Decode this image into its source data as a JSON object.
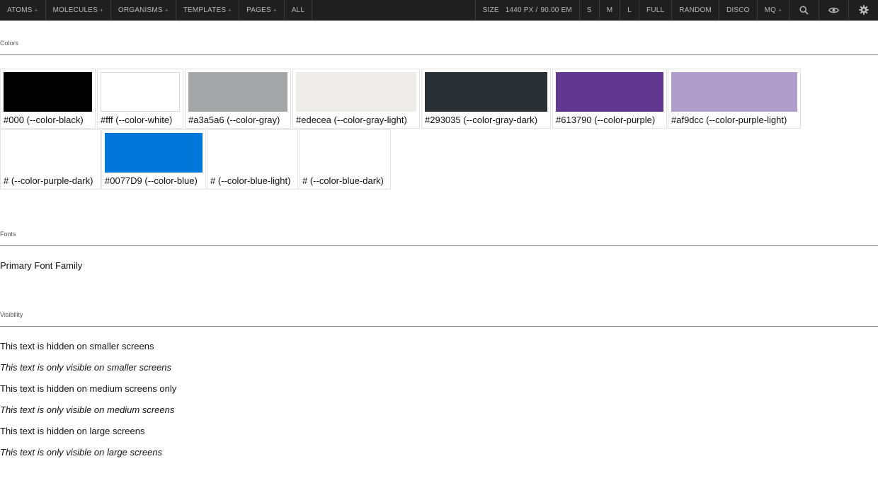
{
  "toolbar": {
    "nav": [
      {
        "label": "ATOMS",
        "has_menu": true
      },
      {
        "label": "MOLECULES",
        "has_menu": true
      },
      {
        "label": "ORGANISMS",
        "has_menu": true
      },
      {
        "label": "TEMPLATES",
        "has_menu": true
      },
      {
        "label": "PAGES",
        "has_menu": true
      },
      {
        "label": "ALL",
        "has_menu": false
      }
    ],
    "plus_glyph": "+",
    "size_label": "SIZE",
    "size_px": "1440 PX /",
    "size_em": "90.00 EM",
    "sizes": [
      "S",
      "M",
      "L",
      "FULL",
      "RANDOM",
      "DISCO",
      "MQ"
    ],
    "icons": [
      "search-icon",
      "eye-icon",
      "gear-icon"
    ]
  },
  "colors_section": {
    "title": "Colors",
    "swatches": [
      {
        "caption": "#000 (--color-black)",
        "color": "#000000"
      },
      {
        "caption": "#fff (--color-white)",
        "color": "#ffffff"
      },
      {
        "caption": "#a3a5a6 (--color-gray)",
        "color": "#a3a5a6"
      },
      {
        "caption": "#edecea (--color-gray-light)",
        "color": "#edecea"
      },
      {
        "caption": "#293035 (--color-gray-dark)",
        "color": "#293035"
      },
      {
        "caption": "#613790 (--color-purple)",
        "color": "#613790"
      },
      {
        "caption": "#af9dcc (--color-purple-light)",
        "color": "#af9dcc"
      },
      {
        "caption": "# (--color-purple-dark)",
        "color": ""
      },
      {
        "caption": "#0077D9 (--color-blue)",
        "color": "#0077D9"
      },
      {
        "caption": "# (--color-blue-light)",
        "color": ""
      },
      {
        "caption": "# (--color-blue-dark)",
        "color": ""
      }
    ]
  },
  "fonts_section": {
    "title": "Fonts",
    "primary": "Primary Font Family"
  },
  "visibility_section": {
    "title": "Visibility",
    "lines": [
      {
        "text": "This text is hidden on smaller screens",
        "italic": false
      },
      {
        "text": "This text is only visible on smaller screens",
        "italic": true
      },
      {
        "text": "This text is hidden on medium screens only",
        "italic": false
      },
      {
        "text": "This text is only visible on medium screens",
        "italic": true
      },
      {
        "text": "This text is hidden on large screens",
        "italic": false
      },
      {
        "text": "This text is only visible on large screens",
        "italic": true
      }
    ]
  }
}
